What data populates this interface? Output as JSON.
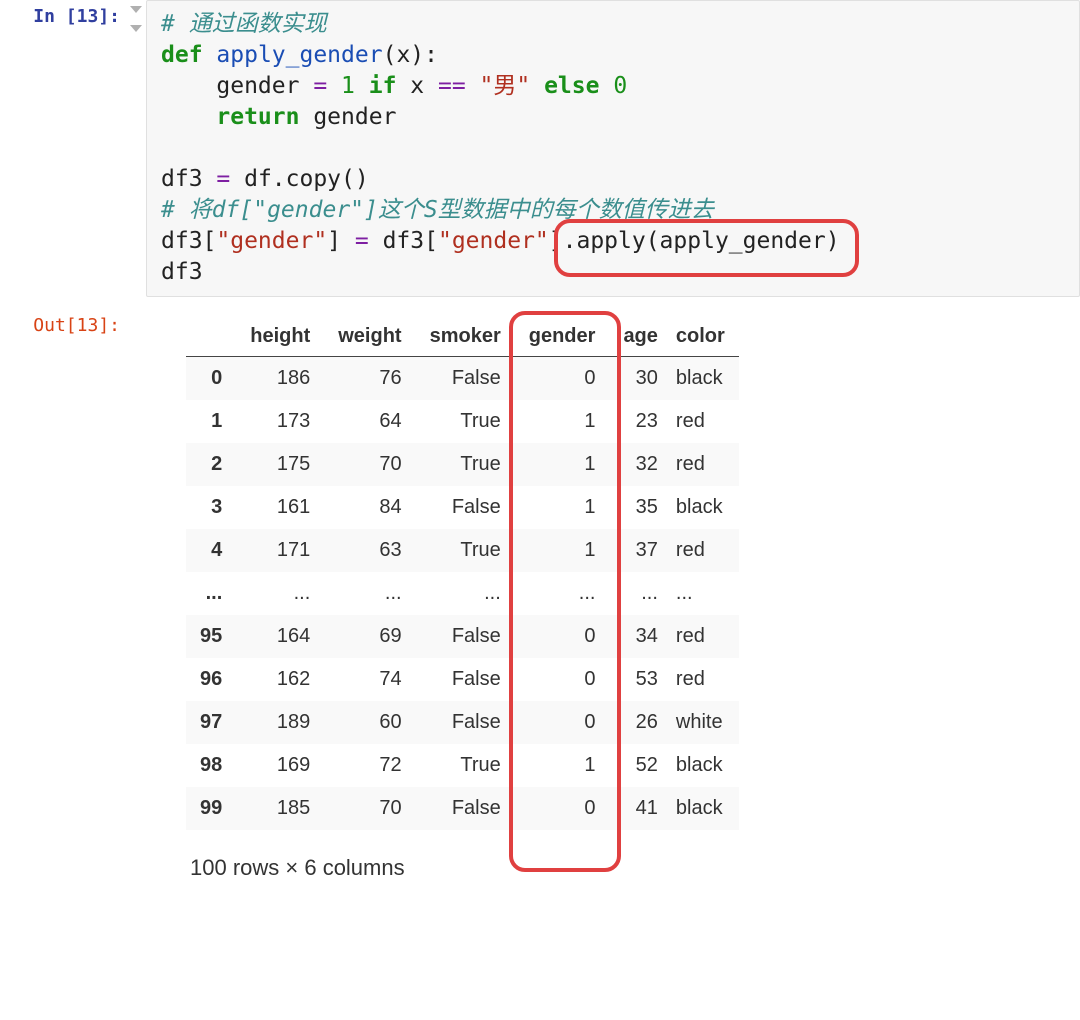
{
  "input_prompt": "In [13]:",
  "output_prompt": "Out[13]:",
  "code": {
    "comment1": "# 通过函数实现",
    "kw_def": "def",
    "fn_name": "apply_gender",
    "paren_open": "(",
    "arg_x": "x",
    "paren_close": "):",
    "indent2a": "    gender ",
    "op_eq": "=",
    "num1": " 1 ",
    "kw_if": "if",
    "space_x": " x ",
    "op_eqeq": "==",
    "str_nan": " \"男\" ",
    "kw_else": "else",
    "num0": " 0",
    "kw_return": "return",
    "ret_val": " gender",
    "assign_df3a": "df3 ",
    "op_assign": "=",
    "df_copy": " df.copy()",
    "comment2": "# 将df[\"gender\"]这个S型数据中的每个数值传进去",
    "lhs_a": "df3[",
    "str_gender1": "\"gender\"",
    "lhs_b": "] ",
    "op_assign2": "=",
    "rhs_a": " df3[",
    "str_gender2": "\"gender\"",
    "rhs_b": "]",
    "apply_call": ".apply(apply_gender)",
    "last_line": "df3"
  },
  "table": {
    "columns": [
      "height",
      "weight",
      "smoker",
      "gender",
      "age",
      "color"
    ],
    "index": [
      "0",
      "1",
      "2",
      "3",
      "4",
      "...",
      "95",
      "96",
      "97",
      "98",
      "99"
    ],
    "rows": [
      [
        "186",
        "76",
        "False",
        "0",
        "30",
        "black"
      ],
      [
        "173",
        "64",
        "True",
        "1",
        "23",
        "red"
      ],
      [
        "175",
        "70",
        "True",
        "1",
        "32",
        "red"
      ],
      [
        "161",
        "84",
        "False",
        "1",
        "35",
        "black"
      ],
      [
        "171",
        "63",
        "True",
        "1",
        "37",
        "red"
      ],
      [
        "...",
        "...",
        "...",
        "...",
        "...",
        "..."
      ],
      [
        "164",
        "69",
        "False",
        "0",
        "34",
        "red"
      ],
      [
        "162",
        "74",
        "False",
        "0",
        "53",
        "red"
      ],
      [
        "189",
        "60",
        "False",
        "0",
        "26",
        "white"
      ],
      [
        "169",
        "72",
        "True",
        "1",
        "52",
        "black"
      ],
      [
        "185",
        "70",
        "False",
        "0",
        "41",
        "black"
      ]
    ],
    "dims_note": "100 rows × 6 columns"
  }
}
